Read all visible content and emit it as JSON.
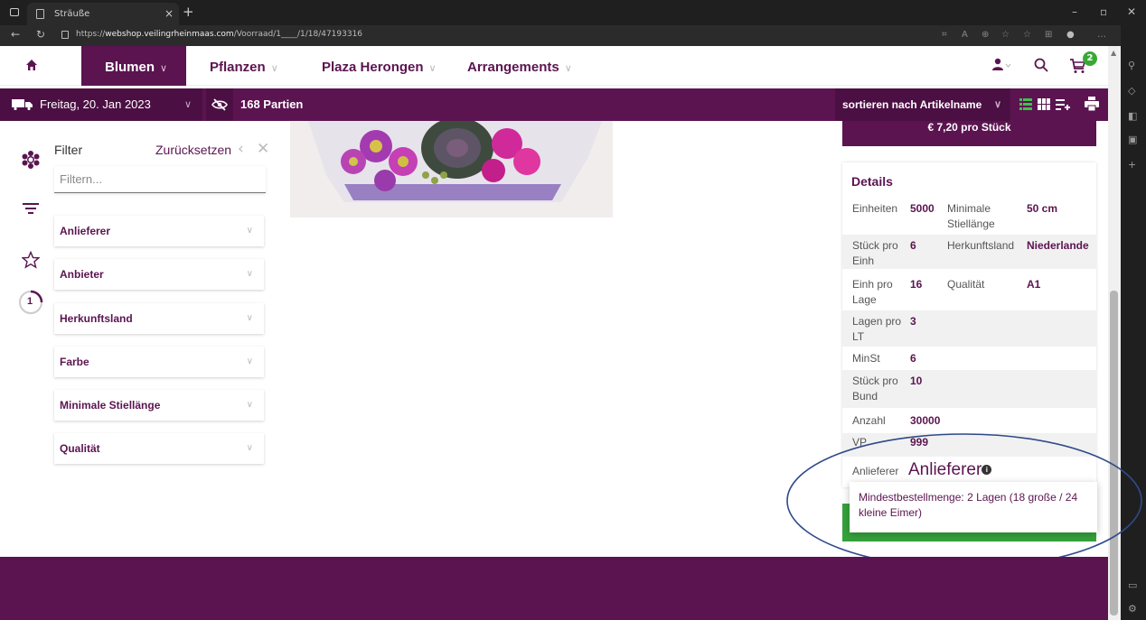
{
  "browser": {
    "tab_title": "Sträuße",
    "url_prefix": "https://",
    "url_domain": "webshop.veilingrheinmaas.com",
    "url_path": "/Voorraad/1____/1/18/47193316"
  },
  "nav": {
    "items": [
      {
        "label": "Blumen"
      },
      {
        "label": "Pflanzen"
      },
      {
        "label": "Plaza Herongen"
      },
      {
        "label": "Arrangements"
      }
    ],
    "cart_count": "2"
  },
  "toolbar": {
    "date": "Freitag, 20. Jan 2023",
    "parties": "168 Partien",
    "sort": "sortieren nach Artikelname"
  },
  "filter": {
    "title": "Filter",
    "reset": "Zurücksetzen",
    "placeholder": "Filtern...",
    "facets": [
      {
        "label": "Anlieferer"
      },
      {
        "label": "Anbieter"
      },
      {
        "label": "Herkunftsland"
      },
      {
        "label": "Farbe"
      },
      {
        "label": "Minimale Stiellänge"
      },
      {
        "label": "Qualität"
      }
    ],
    "badge": "1"
  },
  "product": {
    "price": "€ 7,20 pro Stück",
    "details_title": "Details",
    "rows": [
      {
        "l1": "Einheiten",
        "v1": "5000",
        "l2": "Minimale Stiellänge",
        "v2": "50 cm"
      },
      {
        "l1": "Stück pro Einh",
        "v1": "6",
        "l2": "Herkunftsland",
        "v2": "Niederlande"
      },
      {
        "l1": "Einh pro Lage",
        "v1": "16",
        "l2": "Qualität",
        "v2": "A1"
      },
      {
        "l1": "Lagen pro LT",
        "v1": "3"
      },
      {
        "l1": "MinSt",
        "v1": "6"
      },
      {
        "l1": "Stück pro Bund",
        "v1": "10"
      },
      {
        "l1": "Anzahl",
        "v1": "30000"
      },
      {
        "l1": "VP",
        "v1": "999"
      }
    ],
    "supplier_label": "Anlieferer",
    "supplier_value": "Anlieferer",
    "tooltip": "Mindestbestellmenge: 2 Lagen (18 große / 24 kleine Eimer)"
  },
  "colors": {
    "brand": "#5b1450",
    "accent_green": "#35a23c",
    "annotation": "#2f4a8a"
  }
}
